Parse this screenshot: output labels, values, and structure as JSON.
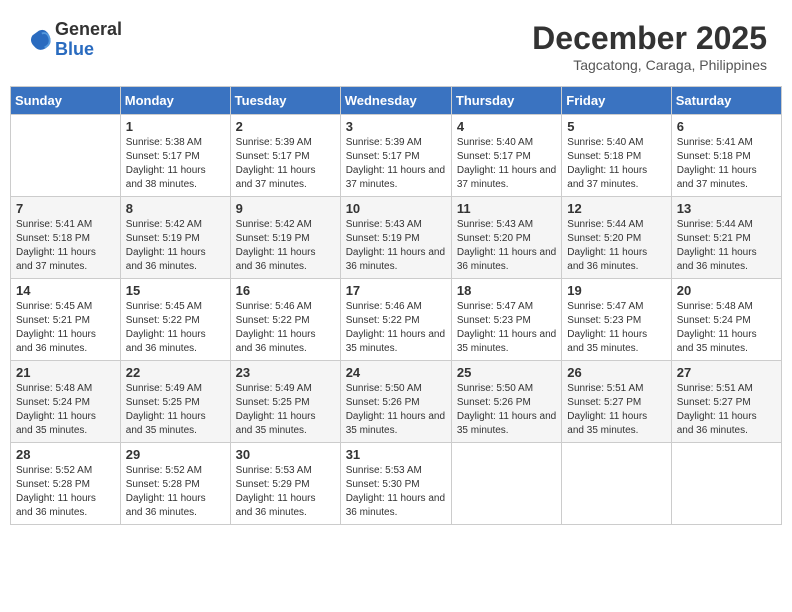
{
  "logo": {
    "general": "General",
    "blue": "Blue"
  },
  "title": "December 2025",
  "subtitle": "Tagcatong, Caraga, Philippines",
  "weekdays": [
    "Sunday",
    "Monday",
    "Tuesday",
    "Wednesday",
    "Thursday",
    "Friday",
    "Saturday"
  ],
  "weeks": [
    [
      {
        "day": "",
        "sunrise": "",
        "sunset": "",
        "daylight": ""
      },
      {
        "day": "1",
        "sunrise": "Sunrise: 5:38 AM",
        "sunset": "Sunset: 5:17 PM",
        "daylight": "Daylight: 11 hours and 38 minutes."
      },
      {
        "day": "2",
        "sunrise": "Sunrise: 5:39 AM",
        "sunset": "Sunset: 5:17 PM",
        "daylight": "Daylight: 11 hours and 37 minutes."
      },
      {
        "day": "3",
        "sunrise": "Sunrise: 5:39 AM",
        "sunset": "Sunset: 5:17 PM",
        "daylight": "Daylight: 11 hours and 37 minutes."
      },
      {
        "day": "4",
        "sunrise": "Sunrise: 5:40 AM",
        "sunset": "Sunset: 5:17 PM",
        "daylight": "Daylight: 11 hours and 37 minutes."
      },
      {
        "day": "5",
        "sunrise": "Sunrise: 5:40 AM",
        "sunset": "Sunset: 5:18 PM",
        "daylight": "Daylight: 11 hours and 37 minutes."
      },
      {
        "day": "6",
        "sunrise": "Sunrise: 5:41 AM",
        "sunset": "Sunset: 5:18 PM",
        "daylight": "Daylight: 11 hours and 37 minutes."
      }
    ],
    [
      {
        "day": "7",
        "sunrise": "Sunrise: 5:41 AM",
        "sunset": "Sunset: 5:18 PM",
        "daylight": "Daylight: 11 hours and 37 minutes."
      },
      {
        "day": "8",
        "sunrise": "Sunrise: 5:42 AM",
        "sunset": "Sunset: 5:19 PM",
        "daylight": "Daylight: 11 hours and 36 minutes."
      },
      {
        "day": "9",
        "sunrise": "Sunrise: 5:42 AM",
        "sunset": "Sunset: 5:19 PM",
        "daylight": "Daylight: 11 hours and 36 minutes."
      },
      {
        "day": "10",
        "sunrise": "Sunrise: 5:43 AM",
        "sunset": "Sunset: 5:19 PM",
        "daylight": "Daylight: 11 hours and 36 minutes."
      },
      {
        "day": "11",
        "sunrise": "Sunrise: 5:43 AM",
        "sunset": "Sunset: 5:20 PM",
        "daylight": "Daylight: 11 hours and 36 minutes."
      },
      {
        "day": "12",
        "sunrise": "Sunrise: 5:44 AM",
        "sunset": "Sunset: 5:20 PM",
        "daylight": "Daylight: 11 hours and 36 minutes."
      },
      {
        "day": "13",
        "sunrise": "Sunrise: 5:44 AM",
        "sunset": "Sunset: 5:21 PM",
        "daylight": "Daylight: 11 hours and 36 minutes."
      }
    ],
    [
      {
        "day": "14",
        "sunrise": "Sunrise: 5:45 AM",
        "sunset": "Sunset: 5:21 PM",
        "daylight": "Daylight: 11 hours and 36 minutes."
      },
      {
        "day": "15",
        "sunrise": "Sunrise: 5:45 AM",
        "sunset": "Sunset: 5:22 PM",
        "daylight": "Daylight: 11 hours and 36 minutes."
      },
      {
        "day": "16",
        "sunrise": "Sunrise: 5:46 AM",
        "sunset": "Sunset: 5:22 PM",
        "daylight": "Daylight: 11 hours and 36 minutes."
      },
      {
        "day": "17",
        "sunrise": "Sunrise: 5:46 AM",
        "sunset": "Sunset: 5:22 PM",
        "daylight": "Daylight: 11 hours and 35 minutes."
      },
      {
        "day": "18",
        "sunrise": "Sunrise: 5:47 AM",
        "sunset": "Sunset: 5:23 PM",
        "daylight": "Daylight: 11 hours and 35 minutes."
      },
      {
        "day": "19",
        "sunrise": "Sunrise: 5:47 AM",
        "sunset": "Sunset: 5:23 PM",
        "daylight": "Daylight: 11 hours and 35 minutes."
      },
      {
        "day": "20",
        "sunrise": "Sunrise: 5:48 AM",
        "sunset": "Sunset: 5:24 PM",
        "daylight": "Daylight: 11 hours and 35 minutes."
      }
    ],
    [
      {
        "day": "21",
        "sunrise": "Sunrise: 5:48 AM",
        "sunset": "Sunset: 5:24 PM",
        "daylight": "Daylight: 11 hours and 35 minutes."
      },
      {
        "day": "22",
        "sunrise": "Sunrise: 5:49 AM",
        "sunset": "Sunset: 5:25 PM",
        "daylight": "Daylight: 11 hours and 35 minutes."
      },
      {
        "day": "23",
        "sunrise": "Sunrise: 5:49 AM",
        "sunset": "Sunset: 5:25 PM",
        "daylight": "Daylight: 11 hours and 35 minutes."
      },
      {
        "day": "24",
        "sunrise": "Sunrise: 5:50 AM",
        "sunset": "Sunset: 5:26 PM",
        "daylight": "Daylight: 11 hours and 35 minutes."
      },
      {
        "day": "25",
        "sunrise": "Sunrise: 5:50 AM",
        "sunset": "Sunset: 5:26 PM",
        "daylight": "Daylight: 11 hours and 35 minutes."
      },
      {
        "day": "26",
        "sunrise": "Sunrise: 5:51 AM",
        "sunset": "Sunset: 5:27 PM",
        "daylight": "Daylight: 11 hours and 35 minutes."
      },
      {
        "day": "27",
        "sunrise": "Sunrise: 5:51 AM",
        "sunset": "Sunset: 5:27 PM",
        "daylight": "Daylight: 11 hours and 36 minutes."
      }
    ],
    [
      {
        "day": "28",
        "sunrise": "Sunrise: 5:52 AM",
        "sunset": "Sunset: 5:28 PM",
        "daylight": "Daylight: 11 hours and 36 minutes."
      },
      {
        "day": "29",
        "sunrise": "Sunrise: 5:52 AM",
        "sunset": "Sunset: 5:28 PM",
        "daylight": "Daylight: 11 hours and 36 minutes."
      },
      {
        "day": "30",
        "sunrise": "Sunrise: 5:53 AM",
        "sunset": "Sunset: 5:29 PM",
        "daylight": "Daylight: 11 hours and 36 minutes."
      },
      {
        "day": "31",
        "sunrise": "Sunrise: 5:53 AM",
        "sunset": "Sunset: 5:30 PM",
        "daylight": "Daylight: 11 hours and 36 minutes."
      },
      {
        "day": "",
        "sunrise": "",
        "sunset": "",
        "daylight": ""
      },
      {
        "day": "",
        "sunrise": "",
        "sunset": "",
        "daylight": ""
      },
      {
        "day": "",
        "sunrise": "",
        "sunset": "",
        "daylight": ""
      }
    ]
  ]
}
